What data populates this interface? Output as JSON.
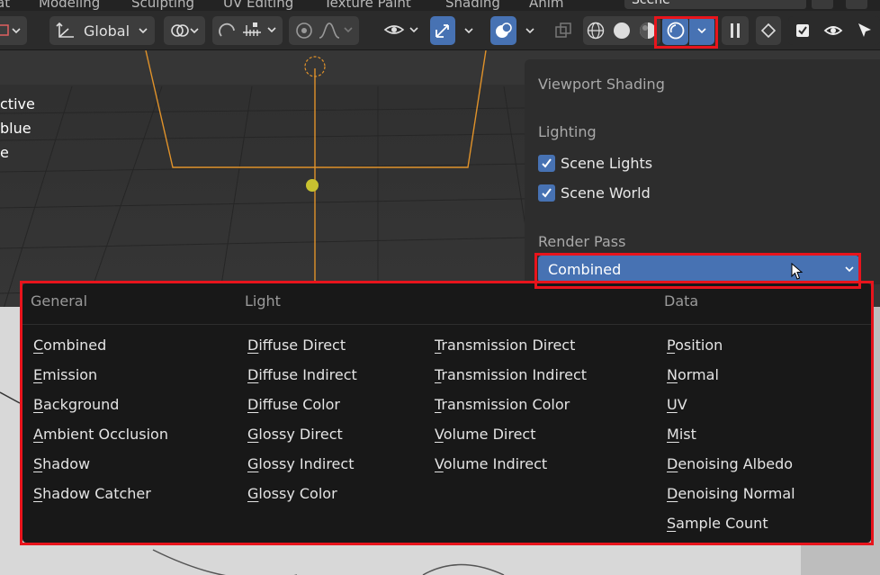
{
  "workspace_tabs": [
    "at",
    "Modeling",
    "Sculpting",
    "UV Editing",
    "Texture Paint",
    "Shading",
    "Anim"
  ],
  "scene_field": "Scene",
  "toolbar": {
    "transform_orientation": "Global"
  },
  "overlay_text": [
    "ctive",
    "blue",
    "e"
  ],
  "shading_panel": {
    "title": "Viewport Shading",
    "lighting_label": "Lighting",
    "scene_lights": {
      "label": "Scene Lights",
      "checked": true
    },
    "scene_world": {
      "label": "Scene World",
      "checked": true
    },
    "render_pass_label": "Render Pass",
    "render_pass_value": "Combined"
  },
  "render_pass_menu": {
    "headers": {
      "general": "General",
      "light": "Light",
      "data": "Data"
    },
    "general": [
      "Combined",
      "Emission",
      "Background",
      "Ambient Occlusion",
      "Shadow",
      "Shadow Catcher"
    ],
    "light_col1": [
      "Diffuse Direct",
      "Diffuse Indirect",
      "Diffuse Color",
      "Glossy Direct",
      "Glossy Indirect",
      "Glossy Color"
    ],
    "light_col2": [
      "Transmission Direct",
      "Transmission Indirect",
      "Transmission Color",
      "Volume Direct",
      "Volume Indirect"
    ],
    "data": [
      "Position",
      "Normal",
      "UV",
      "Mist",
      "Denoising Albedo",
      "Denoising Normal",
      "Sample Count"
    ]
  },
  "colors": {
    "accent": "#4772b3",
    "highlight": "#e8141c",
    "menu_bg": "#181818",
    "panel_bg": "#2d2d2d"
  }
}
